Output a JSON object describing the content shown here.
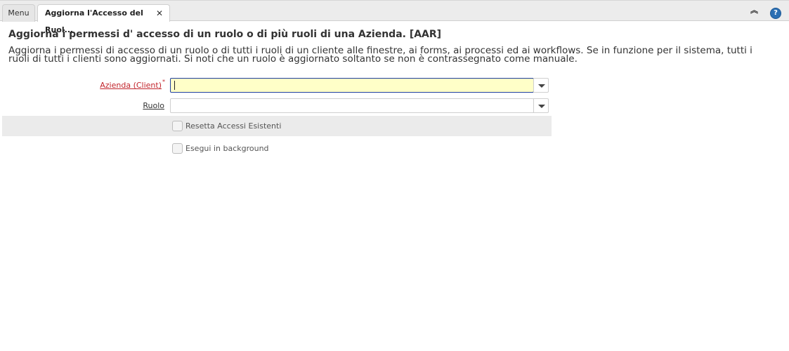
{
  "tabs": {
    "menu_label": "Menu",
    "active_label": "Aggiorna l'Accesso del Ruol...",
    "close_symbol": "✕"
  },
  "toolbar": {
    "collapse_icon": "collapse-up-icon",
    "help_icon": "help-icon",
    "help_glyph": "?"
  },
  "process": {
    "title": "Aggiorna i permessi d' accesso di un ruolo o di più ruoli di una Azienda. [AAR]",
    "description": "Aggiorna i permessi di accesso di un ruolo o di tutti i ruoli di un cliente alle finestre, ai forms, ai processi ed ai workflows. Se in funzione per il sistema, tutti i ruoli di tutti i clienti sono aggiornati. Si noti che un ruolo è aggiornato soltanto se non è contrassegnato come manuale."
  },
  "form": {
    "client_label": "Azienda (Client)",
    "client_required_mark": "*",
    "client_value": "",
    "role_label": "Ruolo",
    "role_value": "",
    "reset_label": "Resetta Accessi Esistenti",
    "reset_checked": false,
    "background_label": "Esegui in background",
    "background_checked": false
  },
  "colors": {
    "required": "#c2252c",
    "focus_border": "#1f3f9f",
    "focus_fill": "#ffffc8",
    "help": "#2b6fb3"
  }
}
